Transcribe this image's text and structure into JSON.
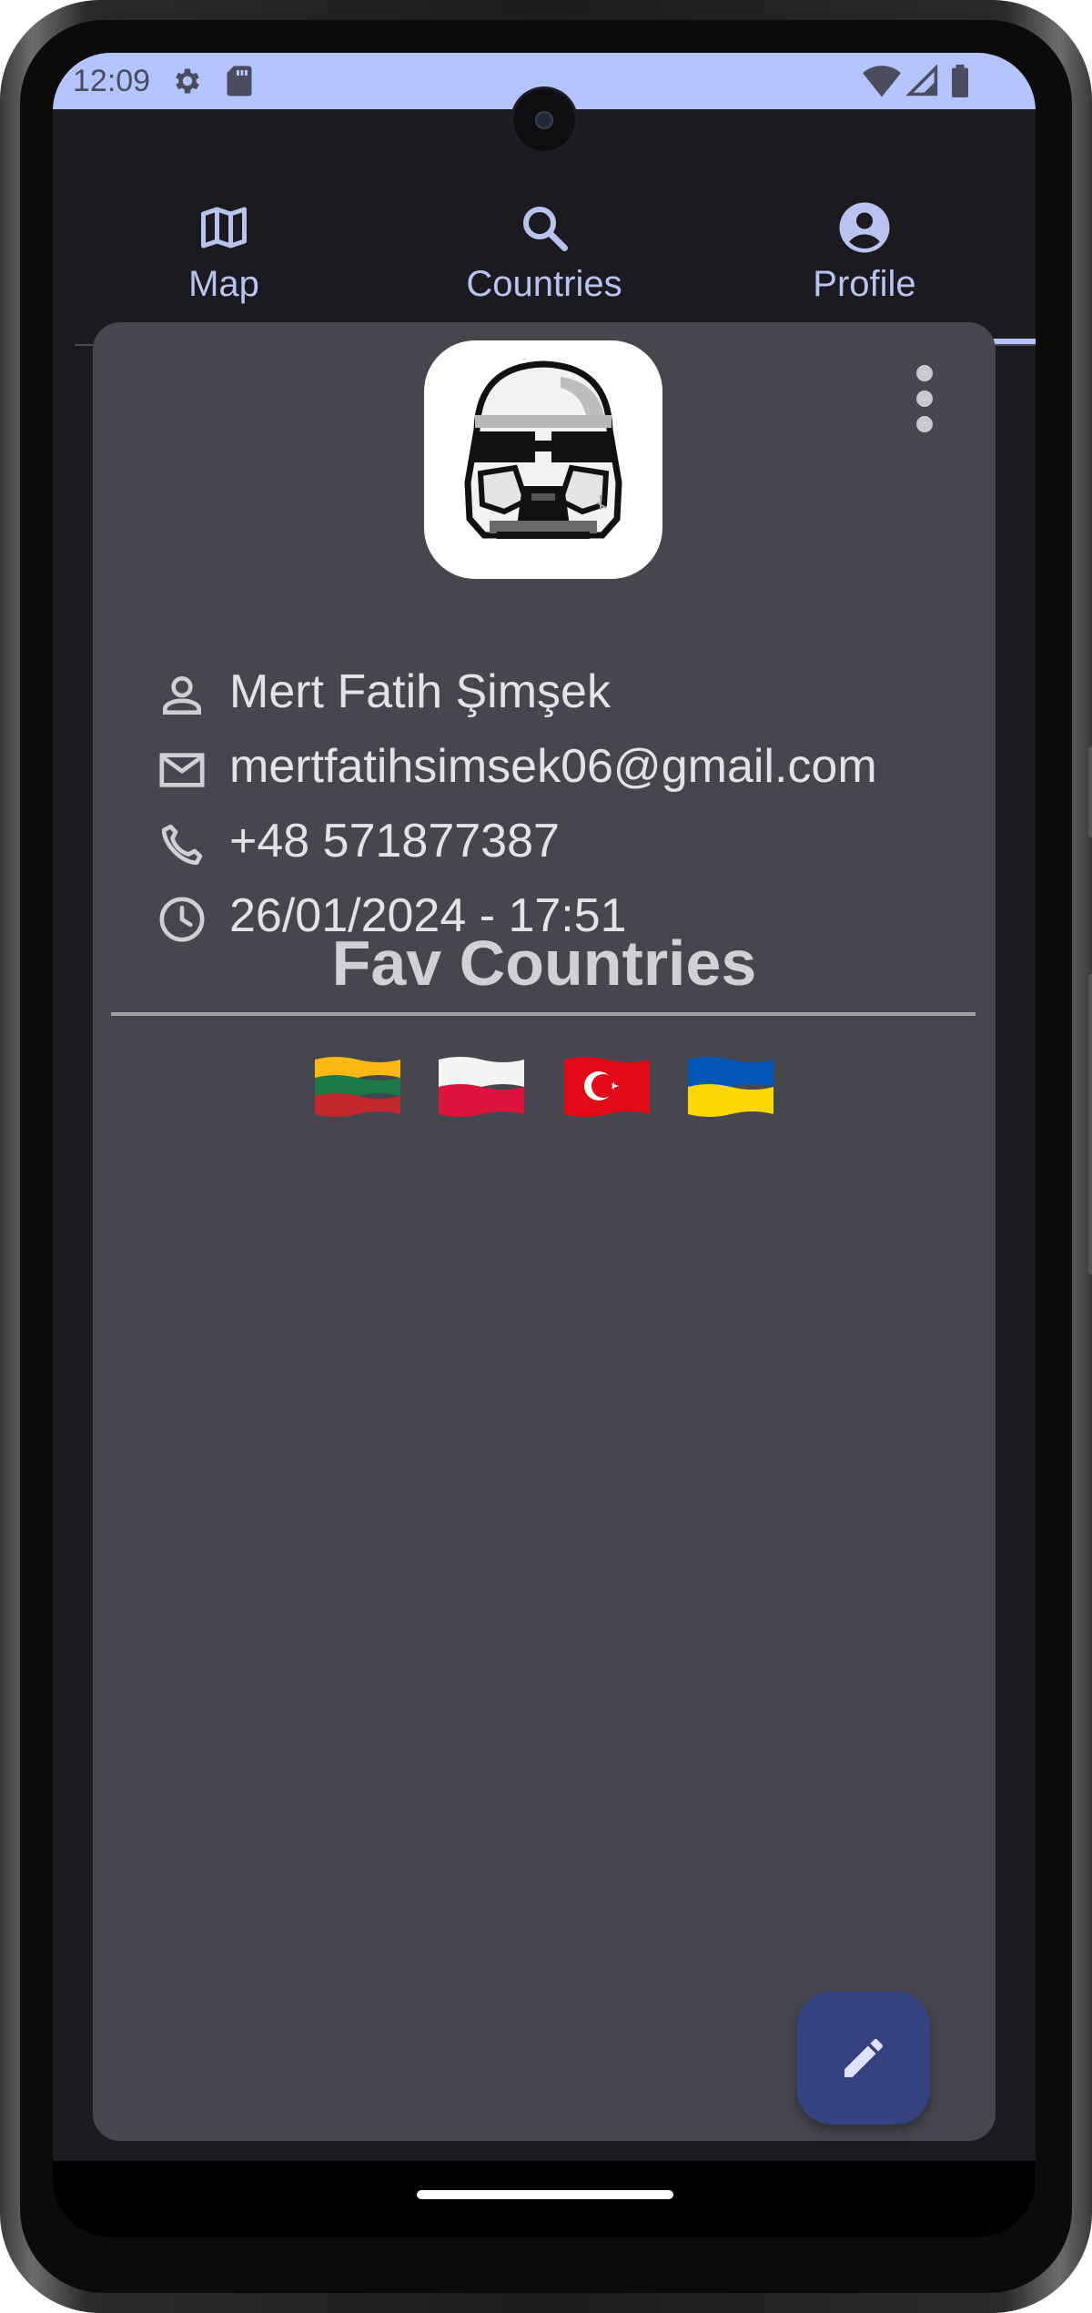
{
  "status_bar": {
    "time": "12:09"
  },
  "tabs": [
    {
      "label": "Map",
      "icon": "map-icon",
      "selected": false
    },
    {
      "label": "Countries",
      "icon": "search-icon",
      "selected": false
    },
    {
      "label": "Profile",
      "icon": "account-circle-icon",
      "selected": true
    }
  ],
  "profile": {
    "name": "Mert Fatih Şimşek",
    "email": "mertfatihsimsek06@gmail.com",
    "phone": "+48 571877387",
    "date": "26/01/2024 - 17:51",
    "avatar": "stormtrooper-pixel-art"
  },
  "favorites": {
    "title": "Fav Countries",
    "flags": [
      "lithuania-flag",
      "poland-flag",
      "turkey-flag",
      "ukraine-flag"
    ]
  },
  "fab": {
    "icon": "edit-pencil-icon"
  },
  "colors": {
    "accent": "#b4c4ff",
    "card": "#46464f",
    "background": "#1b1b1f",
    "fab": "#34437f"
  }
}
